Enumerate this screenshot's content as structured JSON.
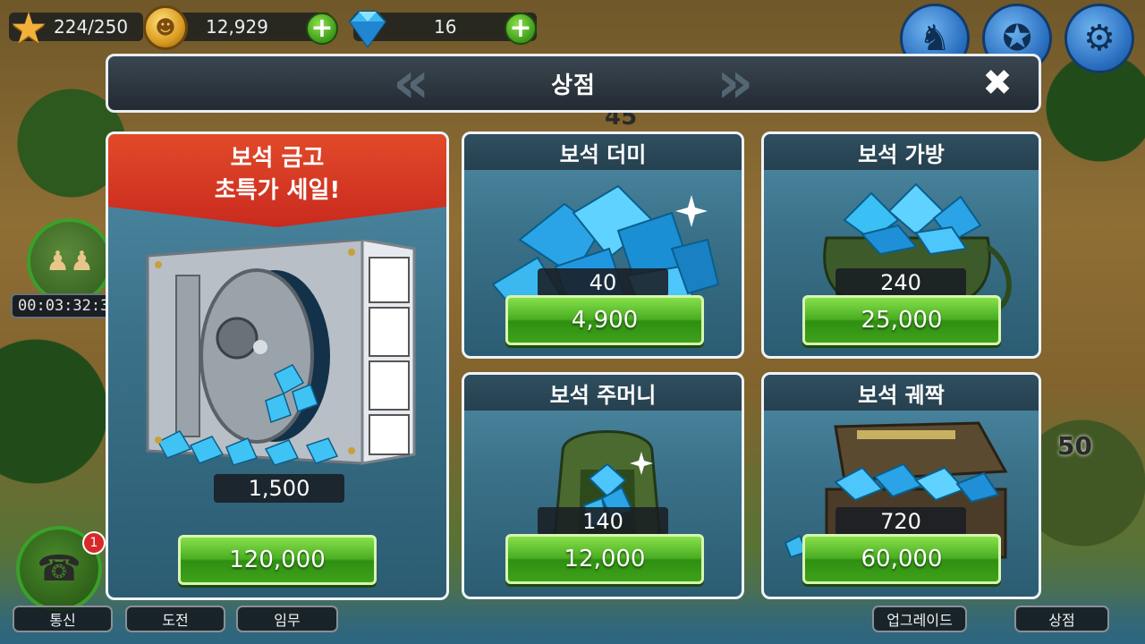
{
  "hud": {
    "xp": "224/250",
    "gold": "12,929",
    "gems": "16",
    "icons": [
      "star-icon",
      "coin-icon",
      "gem-icon",
      "plus-icon",
      "badge-icon",
      "medal-icon",
      "gear-icon"
    ]
  },
  "left_hud": {
    "timer": "00:03:32:3",
    "radio_badge": "1"
  },
  "shop": {
    "title": "상점",
    "close_icon": "close-icon"
  },
  "featured": {
    "title": "보석 금고",
    "subtitle": "초특가 세일!",
    "quantity": "1,500",
    "price": "120,000"
  },
  "items": [
    {
      "name": "보석 더미",
      "quantity": "40",
      "price": "4,900"
    },
    {
      "name": "보석 가방",
      "quantity": "240",
      "price": "25,000"
    },
    {
      "name": "보석 주머니",
      "quantity": "140",
      "price": "12,000"
    },
    {
      "name": "보석 궤짝",
      "quantity": "720",
      "price": "60,000"
    }
  ],
  "map_labels": {
    "level_45": "45",
    "level_50": "50"
  },
  "bottom_nav": {
    "comms": "통신",
    "challenge": "도전",
    "mission": "임무",
    "upgrade": "업그레이드",
    "shop": "상점"
  },
  "colors": {
    "buy_button": "#4aad22",
    "ribbon": "#d0321f",
    "card_bg": "#3a7189",
    "header_bg": "#2a333c"
  }
}
